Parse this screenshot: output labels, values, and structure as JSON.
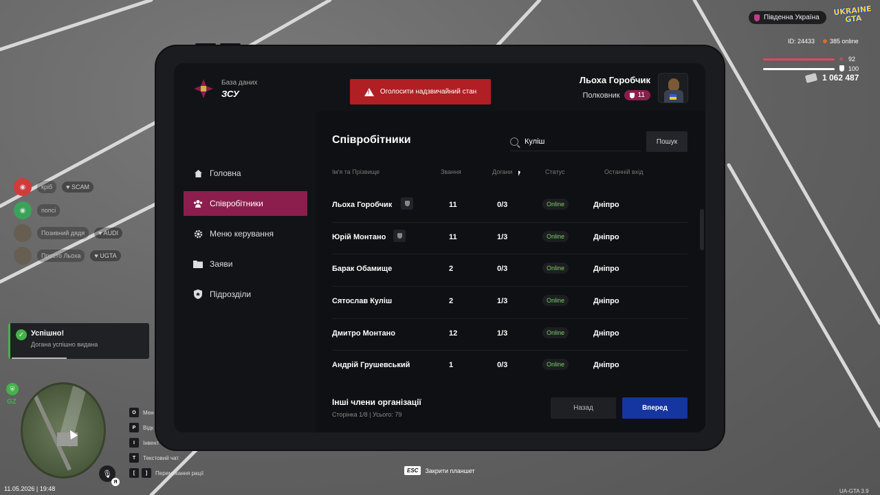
{
  "hud": {
    "region": "Південна Україна",
    "game_logo": "UKRAINE GTA",
    "id_text": "ID: 24433",
    "online_text": "385 online",
    "health": "92",
    "armor": "100",
    "money": "1 062 487",
    "health_fraction": 0.92,
    "armor_fraction": 1.0
  },
  "chat": [
    {
      "name": "кріб",
      "tag": "SCAM"
    },
    {
      "name": "попсі",
      "tag": ""
    },
    {
      "name": "Позивний дядя",
      "tag": "AUDI"
    },
    {
      "name": "Просто Льоха",
      "tag": "UGTA"
    }
  ],
  "toast": {
    "title": "Успішно!",
    "message": "Догана успішно видана"
  },
  "minimap": {
    "gz_label": "GZ",
    "mic_key": "Я"
  },
  "keybinds": [
    {
      "keys": [
        "O"
      ],
      "label": "Мен"
    },
    {
      "keys": [
        "P"
      ],
      "label": "Відк"
    },
    {
      "keys": [
        "I"
      ],
      "label": "Інвент"
    },
    {
      "keys": [
        "T"
      ],
      "label": "Текстовий чат"
    },
    {
      "keys": [
        "[",
        "]"
      ],
      "label": "Перемикання рації"
    }
  ],
  "datetime": "11.05.2026 | 19:48",
  "esc_hint": {
    "key": "ESC",
    "label": "Закрити планшет"
  },
  "version": "UA-GTA 3.9",
  "tablet": {
    "db_label": "База даних",
    "db_name": "ЗСУ",
    "alert_button": "Оголосити надзвичайний стан",
    "user_name": "Льоха Горобчик",
    "user_rank": "Полковник",
    "user_rank_level": "11",
    "nav": [
      {
        "label": "Головна",
        "icon": "home-icon",
        "active": false
      },
      {
        "label": "Співробітники",
        "icon": "users-icon",
        "active": true
      },
      {
        "label": "Меню керування",
        "icon": "gear-icon",
        "active": false
      },
      {
        "label": "Заяви",
        "icon": "folder-icon",
        "active": false
      },
      {
        "label": "Підрозділи",
        "icon": "shield-icon",
        "active": false
      }
    ],
    "section_title": "Співробітники",
    "search_value": "Куліш",
    "search_button": "Пошук",
    "columns": [
      "Ім'я та Прізвище",
      "Звання",
      "Догани",
      "Статус",
      "Останній вхід"
    ],
    "rows": [
      {
        "name": "Льоха Горобчик",
        "badge": true,
        "rank": "11",
        "warnings": "0/3",
        "status": "Online",
        "last_login": "Дніпро"
      },
      {
        "name": "Юрій Монтано",
        "badge": true,
        "rank": "11",
        "warnings": "1/3",
        "status": "Online",
        "last_login": "Дніпро"
      },
      {
        "name": "Барак Обамище",
        "badge": false,
        "rank": "2",
        "warnings": "0/3",
        "status": "Online",
        "last_login": "Дніпро"
      },
      {
        "name": "Сятослав Куліш",
        "badge": false,
        "rank": "2",
        "warnings": "1/3",
        "status": "Online",
        "last_login": "Дніпро"
      },
      {
        "name": "Дмитро Монтано",
        "badge": false,
        "rank": "12",
        "warnings": "1/3",
        "status": "Online",
        "last_login": "Дніпро"
      },
      {
        "name": "Андрій Грушевський",
        "badge": false,
        "rank": "1",
        "warnings": "0/3",
        "status": "Online",
        "last_login": "Дніпро"
      }
    ],
    "others_title": "Інші члени організації",
    "others_sub": "Сторінка 1/8 | Усього: 79",
    "back_button": "Назад",
    "next_button": "Вперед"
  }
}
